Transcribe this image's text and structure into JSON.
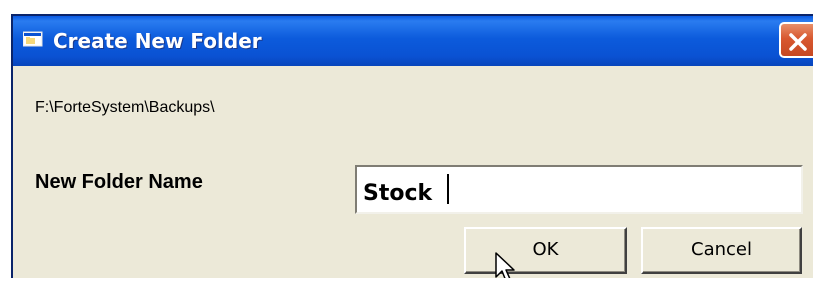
{
  "window": {
    "title": "Create New Folder",
    "close_icon": "close-icon",
    "title_icon": "folder-window-icon"
  },
  "content": {
    "path": "F:\\ForteSystem\\Backups\\",
    "field_label": "New Folder Name",
    "folder_name_value": "Stock"
  },
  "buttons": {
    "ok_label": "OK",
    "cancel_label": "Cancel"
  },
  "colors": {
    "titlebar": "#0a52d3",
    "close_button": "#d8582f",
    "dialog_background": "#ece9d8"
  }
}
